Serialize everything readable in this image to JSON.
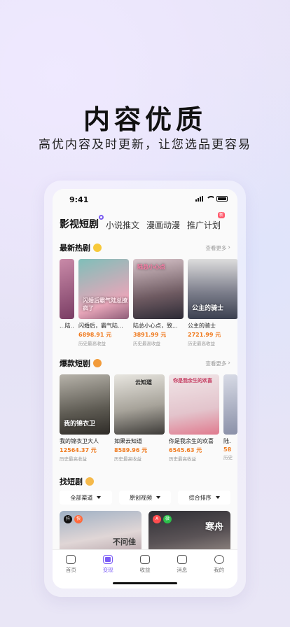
{
  "hero": {
    "title": "内容优质",
    "subtitle": "高优内容及时更新，让您选品更容易"
  },
  "status": {
    "time": "9:41"
  },
  "tabs": [
    {
      "label": "影视短剧",
      "active": true
    },
    {
      "label": "小说推文",
      "active": false
    },
    {
      "label": "漫画动漫",
      "active": false
    },
    {
      "label": "推广计划",
      "active": false,
      "badge": "新"
    }
  ],
  "sections": {
    "latest": {
      "title": "最新热剧",
      "more": "查看更多"
    },
    "hot": {
      "title": "爆款短剧",
      "more": "查看更多"
    },
    "find": {
      "title": "找短剧"
    }
  },
  "latest_cards": [
    {
      "title": "...陆...",
      "price": "",
      "note": ""
    },
    {
      "title": "闪婚后，霸气陆...",
      "price": "6898.91 元",
      "note": "历史最高收益",
      "poster_text": "闪婚后霸气陆总撩疯了"
    },
    {
      "title": "陆总小心点，致...",
      "price": "3891.99 元",
      "note": "历史最高收益",
      "poster_text": "陆总小心点"
    },
    {
      "title": "公主的骑士",
      "price": "2721.99 元",
      "note": "历史最高收益",
      "poster_text": "公主的骑士"
    }
  ],
  "hot_cards": [
    {
      "title": "我的锦衣卫大人",
      "price": "12564.37 元",
      "note": "历史最高收益",
      "poster_text": "我的锦衣卫"
    },
    {
      "title": "如果云知道",
      "price": "8589.96 元",
      "note": "历史最高收益",
      "poster_text": "云知道"
    },
    {
      "title": "你是我余生的欢喜",
      "price": "6545.63 元",
      "note": "历史最高收益",
      "poster_text": "你是我余生的欢喜"
    },
    {
      "title": "陆.",
      "price": "58",
      "note": "历史"
    }
  ],
  "filters": [
    {
      "label": "全部渠道"
    },
    {
      "label": "原创视频"
    },
    {
      "label": "综合排序"
    }
  ],
  "bottom_cards": [
    {
      "badge1": "抖",
      "badge2": "快",
      "poster_text": "不问佳"
    },
    {
      "badge1": "A",
      "badge2": "微",
      "poster_text": "寒舟"
    }
  ],
  "tabbar": [
    {
      "label": "首页",
      "active": false
    },
    {
      "label": "变现",
      "active": true
    },
    {
      "label": "收益",
      "active": false
    },
    {
      "label": "消息",
      "active": false
    },
    {
      "label": "我的",
      "active": false
    }
  ],
  "colors": {
    "accent": "#7b5cf6",
    "price": "#f07a1e"
  }
}
